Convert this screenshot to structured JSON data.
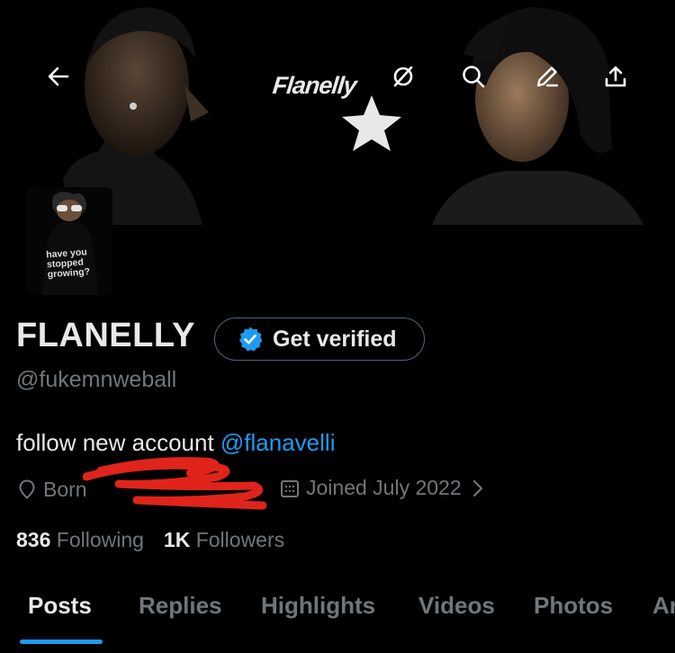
{
  "banner": {
    "title": "Flanelly",
    "avatar_caption": "have you stopped growing?"
  },
  "top_actions": [
    "back-arrow-icon",
    "mute-icon",
    "search-icon",
    "edit-icon",
    "share-icon"
  ],
  "profile": {
    "display_name": "FLANELLY",
    "verify_label": "Get verified",
    "handle": "@fukemnweball",
    "bio_text": "follow new account ",
    "bio_mention": "@flanavelli",
    "location_prefix": "Born",
    "joined": "Joined July 2022",
    "following_count": "836",
    "following_label": "Following",
    "followers_count": "1K",
    "followers_label": "Followers"
  },
  "tabs": [
    {
      "label": "Posts"
    },
    {
      "label": "Replies"
    },
    {
      "label": "Highlights"
    },
    {
      "label": "Videos"
    },
    {
      "label": "Photos"
    },
    {
      "label": "Ar"
    }
  ],
  "colors": {
    "background": "#000000",
    "accent": "#1d9bf0",
    "muted": "#71767b",
    "text": "#e7e9ea",
    "redaction": "#e0241b"
  }
}
